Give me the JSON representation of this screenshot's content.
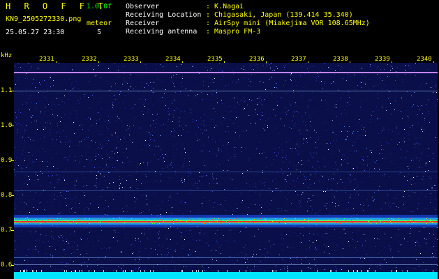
{
  "header": {
    "app_title": "H R O F F T",
    "version": "1.0.0f",
    "filename": "KN9_2505272330.png",
    "timestamp": "25.05.27 23:30",
    "meteor_label": "meteor",
    "meteor_count": "5",
    "info": [
      {
        "label": "Observer",
        "value": ": K.Nagai"
      },
      {
        "label": "Receiving Location",
        "value": ": Chigasaki, Japan (139.414 35.340)"
      },
      {
        "label": "Receiver",
        "value": ": AirSpy mini (Miakejima VOR 108.65MHz)"
      },
      {
        "label": "Receiving antenna",
        "value": ": Maspro FM-3"
      }
    ]
  },
  "axis": {
    "y_unit": "kHz",
    "y_ticks": [
      "1.1",
      "1.0",
      "0.9",
      "0.8",
      "0.7",
      "0.6"
    ],
    "x_ticks": [
      "2331",
      "2332",
      "2333",
      "2334",
      "2335",
      "2336",
      "2337",
      "2338",
      "2339",
      "2340"
    ]
  },
  "colors": {
    "background": "#000000",
    "label": "#ffff00",
    "text": "#ffffff",
    "accent": "#00ff00",
    "noise_floor": "#0a0f4a",
    "signal_band": "#ff2a2a",
    "bottom_band": "#00e5ff"
  }
}
